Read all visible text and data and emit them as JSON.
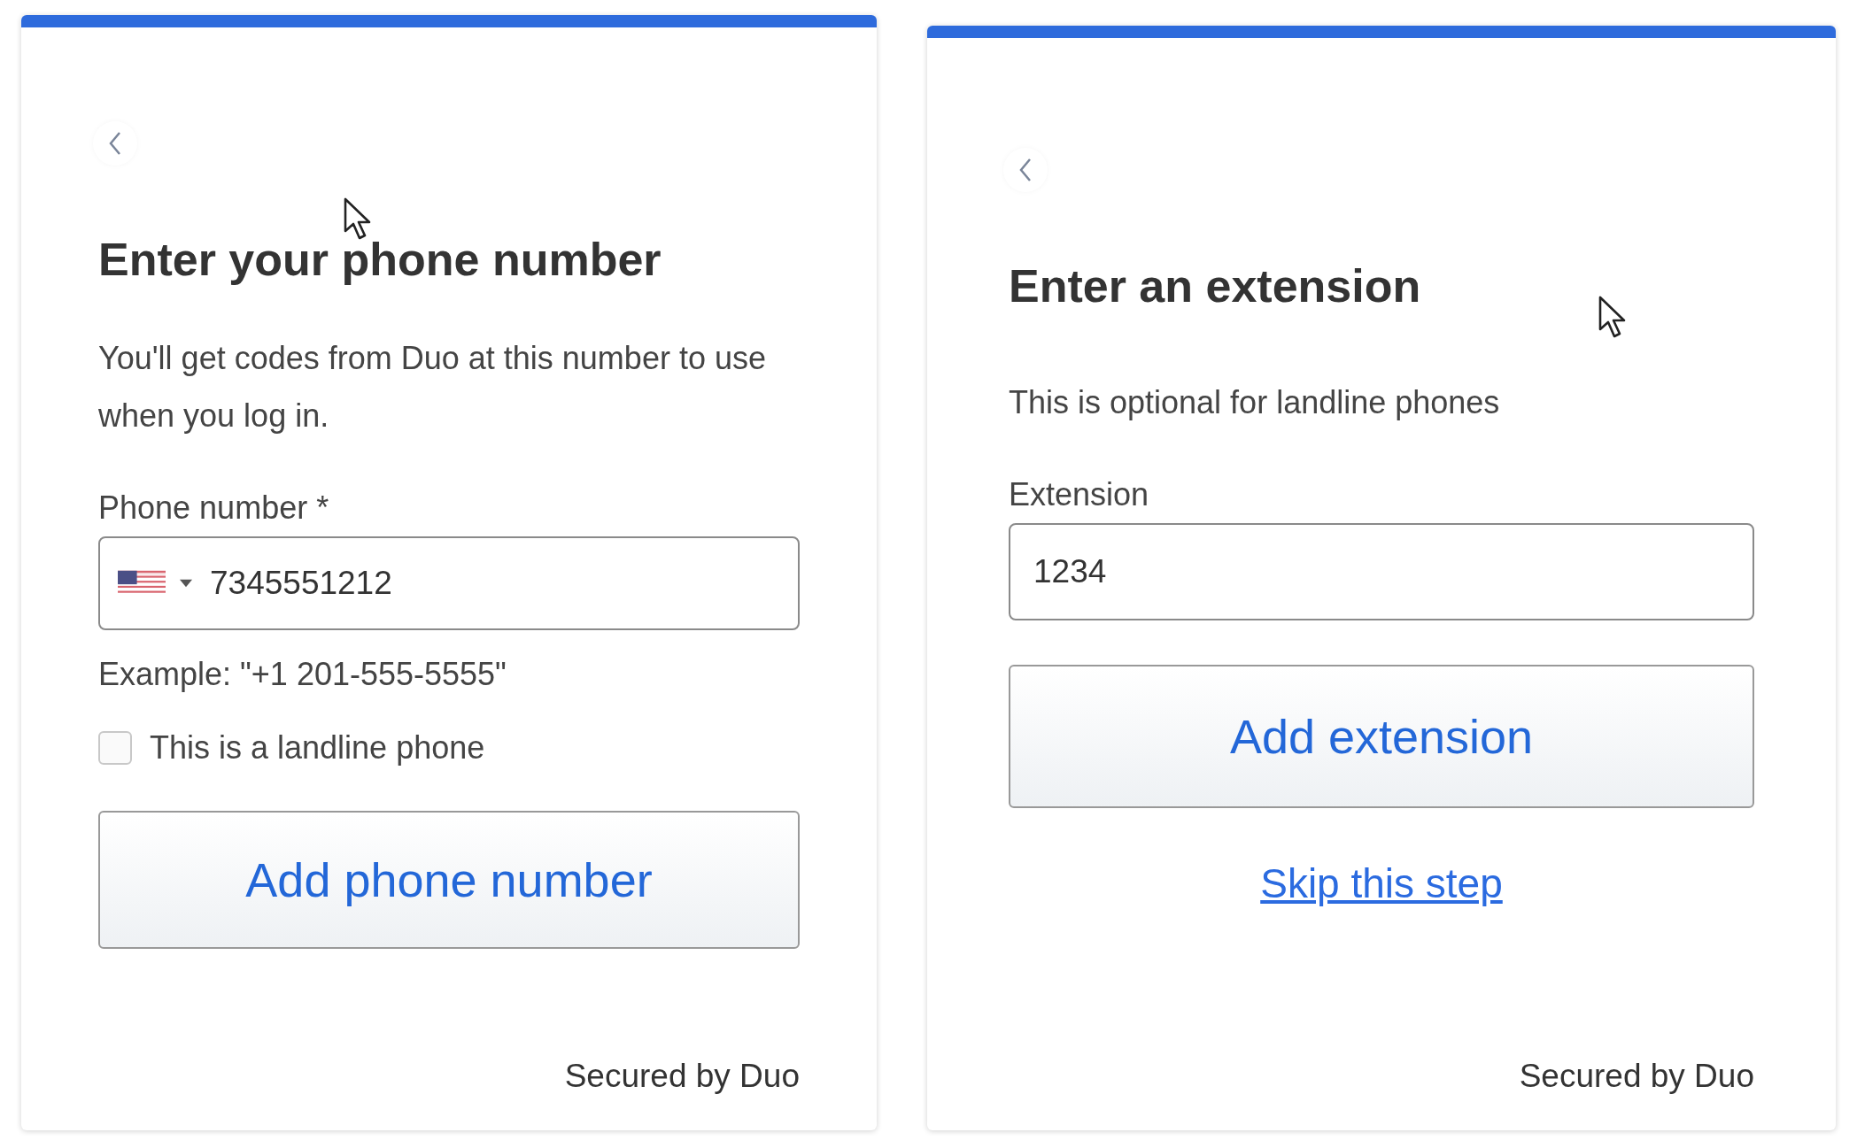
{
  "cards": [
    {
      "title": "Enter your phone number",
      "description": "You'll get codes from Duo at this number to use when you log in.",
      "items": [
        {
          "kind": "label",
          "text": "Phone number *"
        },
        {
          "kind": "phone_input",
          "value": "7345551212"
        },
        {
          "kind": "hint",
          "text": "Example: \"+1 201-555-5555\""
        },
        {
          "kind": "checkbox",
          "text": "This is a landline phone",
          "checked": false
        },
        {
          "kind": "button",
          "text": "Add phone number"
        }
      ],
      "footer": "Secured by Duo"
    },
    {
      "title": "Enter an extension",
      "description": "This is optional for landline phones",
      "items": [
        {
          "kind": "label",
          "text": "Extension"
        },
        {
          "kind": "text_input",
          "value": "1234"
        },
        {
          "kind": "button",
          "text": "Add extension"
        },
        {
          "kind": "link",
          "text": "Skip this step"
        }
      ],
      "footer": "Secured by Duo"
    }
  ]
}
